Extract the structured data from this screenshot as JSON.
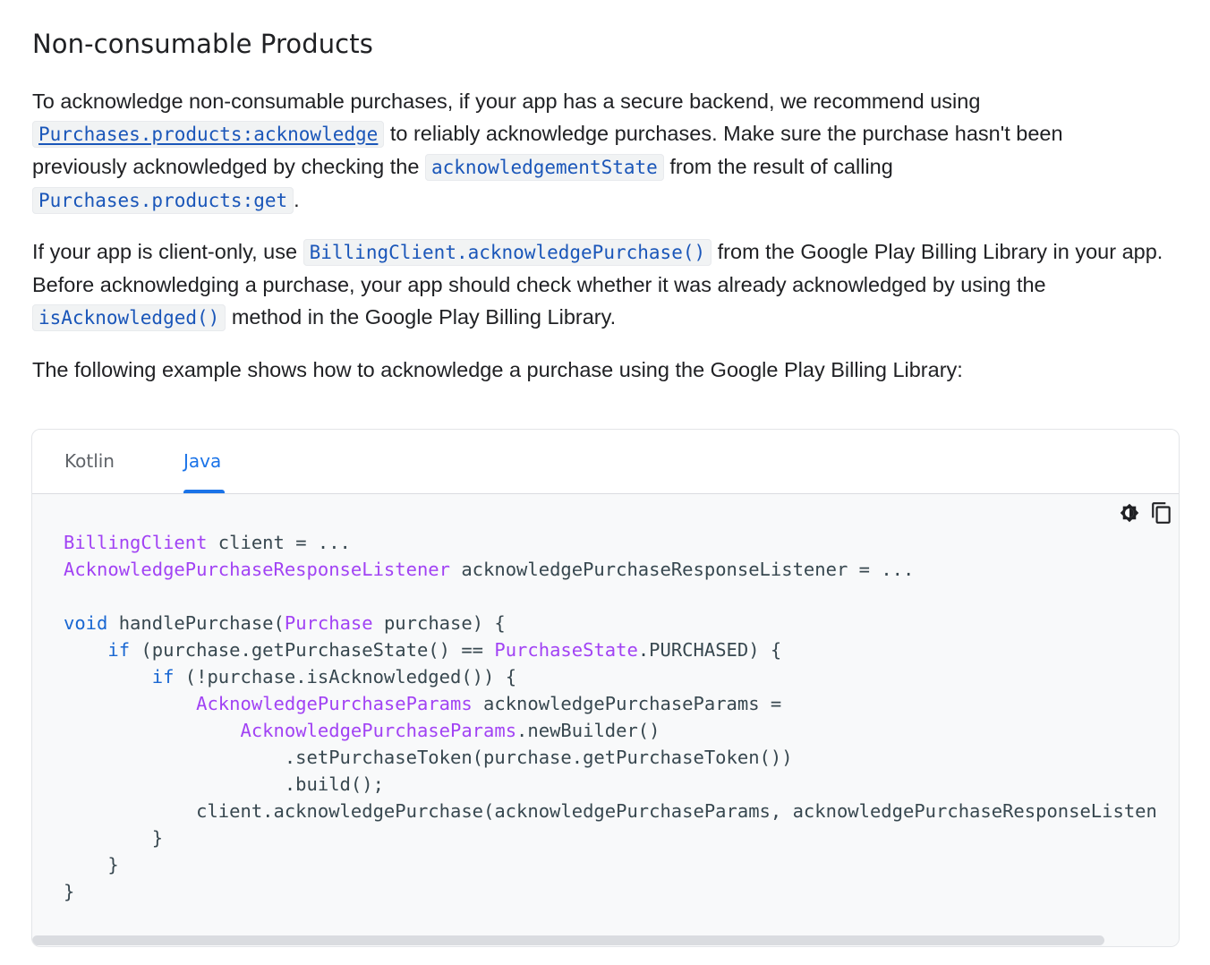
{
  "heading": "Non-consumable Products",
  "para1": {
    "text1": "To acknowledge non-consumable purchases, if your app has a secure backend, we recommend using",
    "link1": "Purchases.products:acknowledge",
    "text2": "to reliably acknowledge purchases. Make sure the purchase hasn't been",
    "text3": "previously acknowledged by checking the",
    "code1": "acknowledgementState",
    "text4": "from the result of calling",
    "code2": "Purchases.products:get",
    "text5": "."
  },
  "para2": {
    "text1": "If your app is client-only, use",
    "code1": "BillingClient.acknowledgePurchase()",
    "text2": "from the Google Play Billing Library in your app.",
    "text3": "Before acknowledging a purchase, your app should check whether it was already acknowledged by using the",
    "code2": "isAcknowledged()",
    "text4": "method in the Google Play Billing Library."
  },
  "para3": "The following example shows how to acknowledge a purchase using the Google Play Billing Library:",
  "code_tabs": [
    "Kotlin",
    "Java"
  ],
  "active_tab": "Java",
  "toolbar": {
    "theme_icon": "contrast-icon",
    "copy_icon": "copy-icon"
  },
  "code_lines": [
    [
      [
        "type",
        "BillingClient"
      ],
      [
        "pl",
        " client = ..."
      ]
    ],
    [
      [
        "type",
        "AcknowledgePurchaseResponseListener"
      ],
      [
        "pl",
        " acknowledgePurchaseResponseListener = ..."
      ]
    ],
    [],
    [
      [
        "kw",
        "void"
      ],
      [
        "pl",
        " handlePurchase("
      ],
      [
        "type",
        "Purchase"
      ],
      [
        "pl",
        " purchase) {"
      ]
    ],
    [
      [
        "pl",
        "    "
      ],
      [
        "kw",
        "if"
      ],
      [
        "pl",
        " (purchase.getPurchaseState() == "
      ],
      [
        "type",
        "PurchaseState"
      ],
      [
        "pl",
        ".PURCHASED) {"
      ]
    ],
    [
      [
        "pl",
        "        "
      ],
      [
        "kw",
        "if"
      ],
      [
        "pl",
        " (!purchase.isAcknowledged()) {"
      ]
    ],
    [
      [
        "pl",
        "            "
      ],
      [
        "type",
        "AcknowledgePurchaseParams"
      ],
      [
        "pl",
        " acknowledgePurchaseParams ="
      ]
    ],
    [
      [
        "pl",
        "                "
      ],
      [
        "type",
        "AcknowledgePurchaseParams"
      ],
      [
        "pl",
        ".newBuilder()"
      ]
    ],
    [
      [
        "pl",
        "                    .setPurchaseToken(purchase.getPurchaseToken())"
      ]
    ],
    [
      [
        "pl",
        "                    .build();"
      ]
    ],
    [
      [
        "pl",
        "            client.acknowledgePurchase(acknowledgePurchaseParams, acknowledgePurchaseResponseListen"
      ]
    ],
    [
      [
        "pl",
        "        }"
      ]
    ],
    [
      [
        "pl",
        "    }"
      ]
    ],
    [
      [
        "pl",
        "}"
      ]
    ]
  ]
}
